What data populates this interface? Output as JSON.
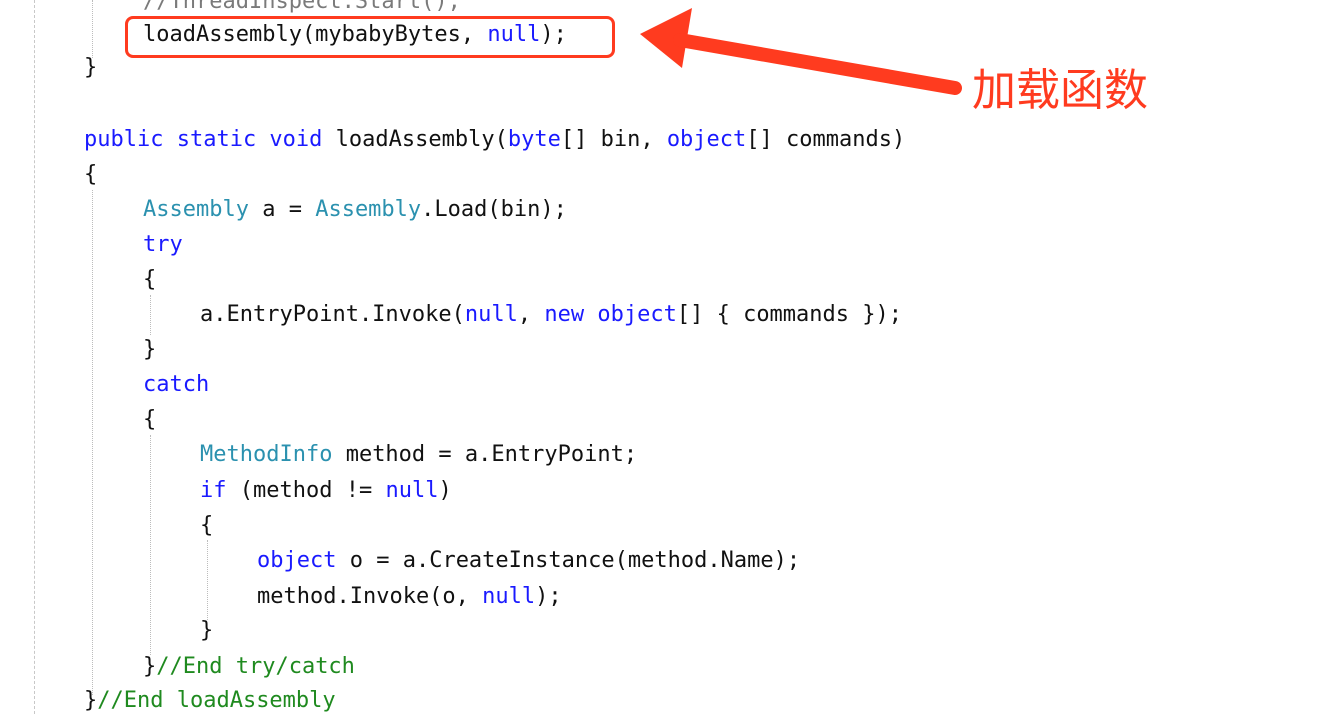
{
  "code": {
    "lines": [
      [
        {
          "t": "//ThreadInspect.Start();",
          "c": "faded"
        }
      ],
      [
        {
          "t": "loadAssembly(mybabyBytes, ",
          "c": "plain"
        },
        {
          "t": "null",
          "c": "kw"
        },
        {
          "t": ");",
          "c": "plain"
        }
      ],
      [
        {
          "t": "}",
          "c": "plain"
        }
      ],
      [],
      [
        {
          "t": "public static void ",
          "c": "kw"
        },
        {
          "t": "loadAssembly(",
          "c": "plain"
        },
        {
          "t": "byte",
          "c": "kw"
        },
        {
          "t": "[] bin, ",
          "c": "plain"
        },
        {
          "t": "object",
          "c": "kw"
        },
        {
          "t": "[] commands)",
          "c": "plain"
        }
      ],
      [
        {
          "t": "{",
          "c": "plain"
        }
      ],
      [
        {
          "t": "Assembly",
          "c": "typ"
        },
        {
          "t": " a = ",
          "c": "plain"
        },
        {
          "t": "Assembly",
          "c": "typ"
        },
        {
          "t": ".Load(bin);",
          "c": "plain"
        }
      ],
      [
        {
          "t": "try",
          "c": "kw"
        }
      ],
      [
        {
          "t": "{",
          "c": "plain"
        }
      ],
      [
        {
          "t": "a.EntryPoint.Invoke(",
          "c": "plain"
        },
        {
          "t": "null",
          "c": "kw"
        },
        {
          "t": ", ",
          "c": "plain"
        },
        {
          "t": "new object",
          "c": "kw"
        },
        {
          "t": "[] { commands });",
          "c": "plain"
        }
      ],
      [
        {
          "t": "}",
          "c": "plain"
        }
      ],
      [
        {
          "t": "catch",
          "c": "kw"
        }
      ],
      [
        {
          "t": "{",
          "c": "plain"
        }
      ],
      [
        {
          "t": "MethodInfo",
          "c": "typ"
        },
        {
          "t": " method = a.EntryPoint;",
          "c": "plain"
        }
      ],
      [
        {
          "t": "if",
          "c": "kw"
        },
        {
          "t": " (method != ",
          "c": "plain"
        },
        {
          "t": "null",
          "c": "kw"
        },
        {
          "t": ")",
          "c": "plain"
        }
      ],
      [
        {
          "t": "{",
          "c": "plain"
        }
      ],
      [
        {
          "t": "object",
          "c": "kw"
        },
        {
          "t": " o = a.CreateInstance(method.Name);",
          "c": "plain"
        }
      ],
      [
        {
          "t": "method.Invoke(o, ",
          "c": "plain"
        },
        {
          "t": "null",
          "c": "kw"
        },
        {
          "t": ");",
          "c": "plain"
        }
      ],
      [
        {
          "t": "}",
          "c": "plain"
        }
      ],
      [
        {
          "t": "}",
          "c": "plain"
        },
        {
          "t": "//End try/catch",
          "c": "cmt"
        }
      ],
      [
        {
          "t": "}",
          "c": "plain"
        },
        {
          "t": "//End loadAssembly",
          "c": "cmt"
        }
      ]
    ]
  },
  "annotation": {
    "label": "加载函数",
    "color": "#ff3b1f"
  },
  "colors": {
    "keyword": "#1a1aff",
    "type": "#2b91af",
    "comment": "#1f8a1f",
    "text": "#111111"
  }
}
